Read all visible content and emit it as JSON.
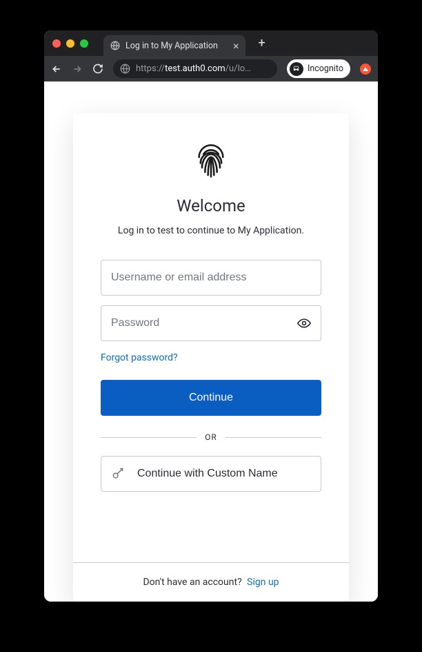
{
  "browser": {
    "tab_title": "Log in to My Application",
    "url_prefix": "https://",
    "url_host": "test.auth0.com",
    "url_path": "/u/lo…",
    "incognito_label": "Incognito"
  },
  "login": {
    "heading": "Welcome",
    "subtitle": "Log in to test to continue to My Application.",
    "username_placeholder": "Username or email address",
    "password_placeholder": "Password",
    "forgot_label": "Forgot password?",
    "continue_label": "Continue",
    "or_label": "OR",
    "social_label": "Continue with Custom Name",
    "footer_text": "Don't have an account?",
    "signup_label": "Sign up"
  }
}
